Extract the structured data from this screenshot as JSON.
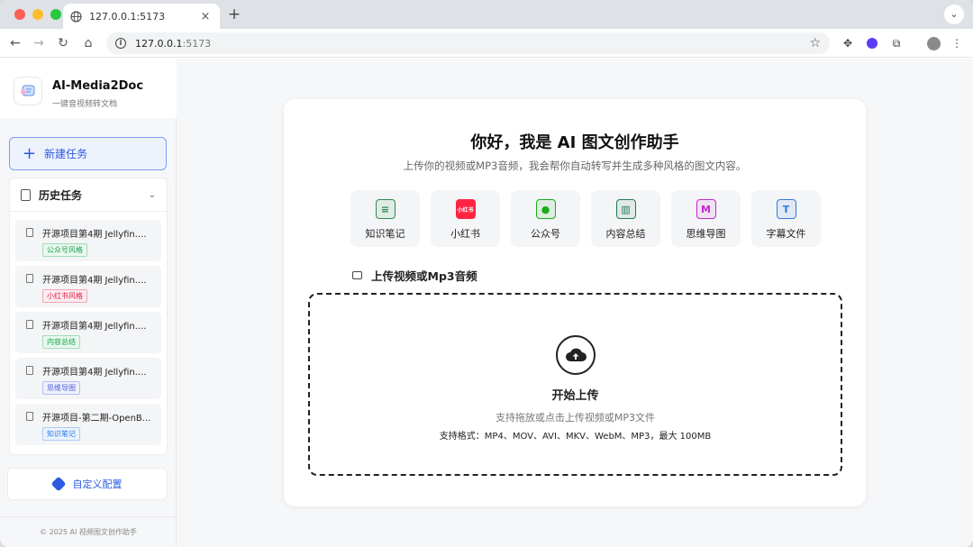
{
  "browser": {
    "tab_title": "127.0.0.1:5173",
    "tab_close": "×",
    "new_tab": "+",
    "url_host": "127.0.0.1",
    "url_port": ":5173",
    "tab_menu": "⌄"
  },
  "sidebar": {
    "brand_title": "AI-Media2Doc",
    "brand_subtitle": "一键音视频转文档",
    "new_task": "新建任务",
    "history_title": "历史任务",
    "history": [
      {
        "title": "开源项目第4期 Jellyfin....",
        "tag": "公众号风格",
        "tag_color": "#16a34a",
        "tag_bg": "#e9f8ee"
      },
      {
        "title": "开源项目第4期 Jellyfin....",
        "tag": "小红书风格",
        "tag_color": "#e11d48",
        "tag_bg": "#fdecef"
      },
      {
        "title": "开源项目第4期 Jellyfin....",
        "tag": "内容总结",
        "tag_color": "#16a34a",
        "tag_bg": "#e9f8ee"
      },
      {
        "title": "开源项目第4期 Jellyfin....",
        "tag": "思维导图",
        "tag_color": "#4f5fd8",
        "tag_bg": "#eef0fc"
      },
      {
        "title": "开源项目-第二期-OpenB...",
        "tag": "知识笔记",
        "tag_color": "#2c7be0",
        "tag_bg": "#eaf3fd"
      }
    ],
    "custom_config": "自定义配置",
    "copyright": "© 2025 AI 视频图文创作助手"
  },
  "main": {
    "title": "你好，我是 AI 图文创作助手",
    "subtitle": "上传你的视频或MP3音频，我会帮你自动转写并生成多种风格的图文内容。",
    "styles": [
      {
        "label": "知识笔记",
        "icon": "notebook-icon",
        "color": "#2f8a4b",
        "glyph": "≡"
      },
      {
        "label": "小红书",
        "icon": "xiaohongshu-icon",
        "color": "#ff2442",
        "glyph": "小红书"
      },
      {
        "label": "公众号",
        "icon": "wechat-icon",
        "color": "#1aad19",
        "glyph": "●"
      },
      {
        "label": "内容总结",
        "icon": "summary-icon",
        "color": "#1e7a5a",
        "glyph": "▥"
      },
      {
        "label": "思维导图",
        "icon": "mindmap-icon",
        "color": "#c026d3",
        "glyph": "M"
      },
      {
        "label": "字幕文件",
        "icon": "subtitle-icon",
        "color": "#2c7be0",
        "glyph": "T"
      }
    ],
    "upload_heading": "上传视频或Mp3音频",
    "drop_title": "开始上传",
    "drop_hint": "支持拖放或点击上传视频或MP3文件",
    "drop_formats": "支持格式：MP4、MOV、AVI、MKV、WebM、MP3，最大 100MB"
  }
}
